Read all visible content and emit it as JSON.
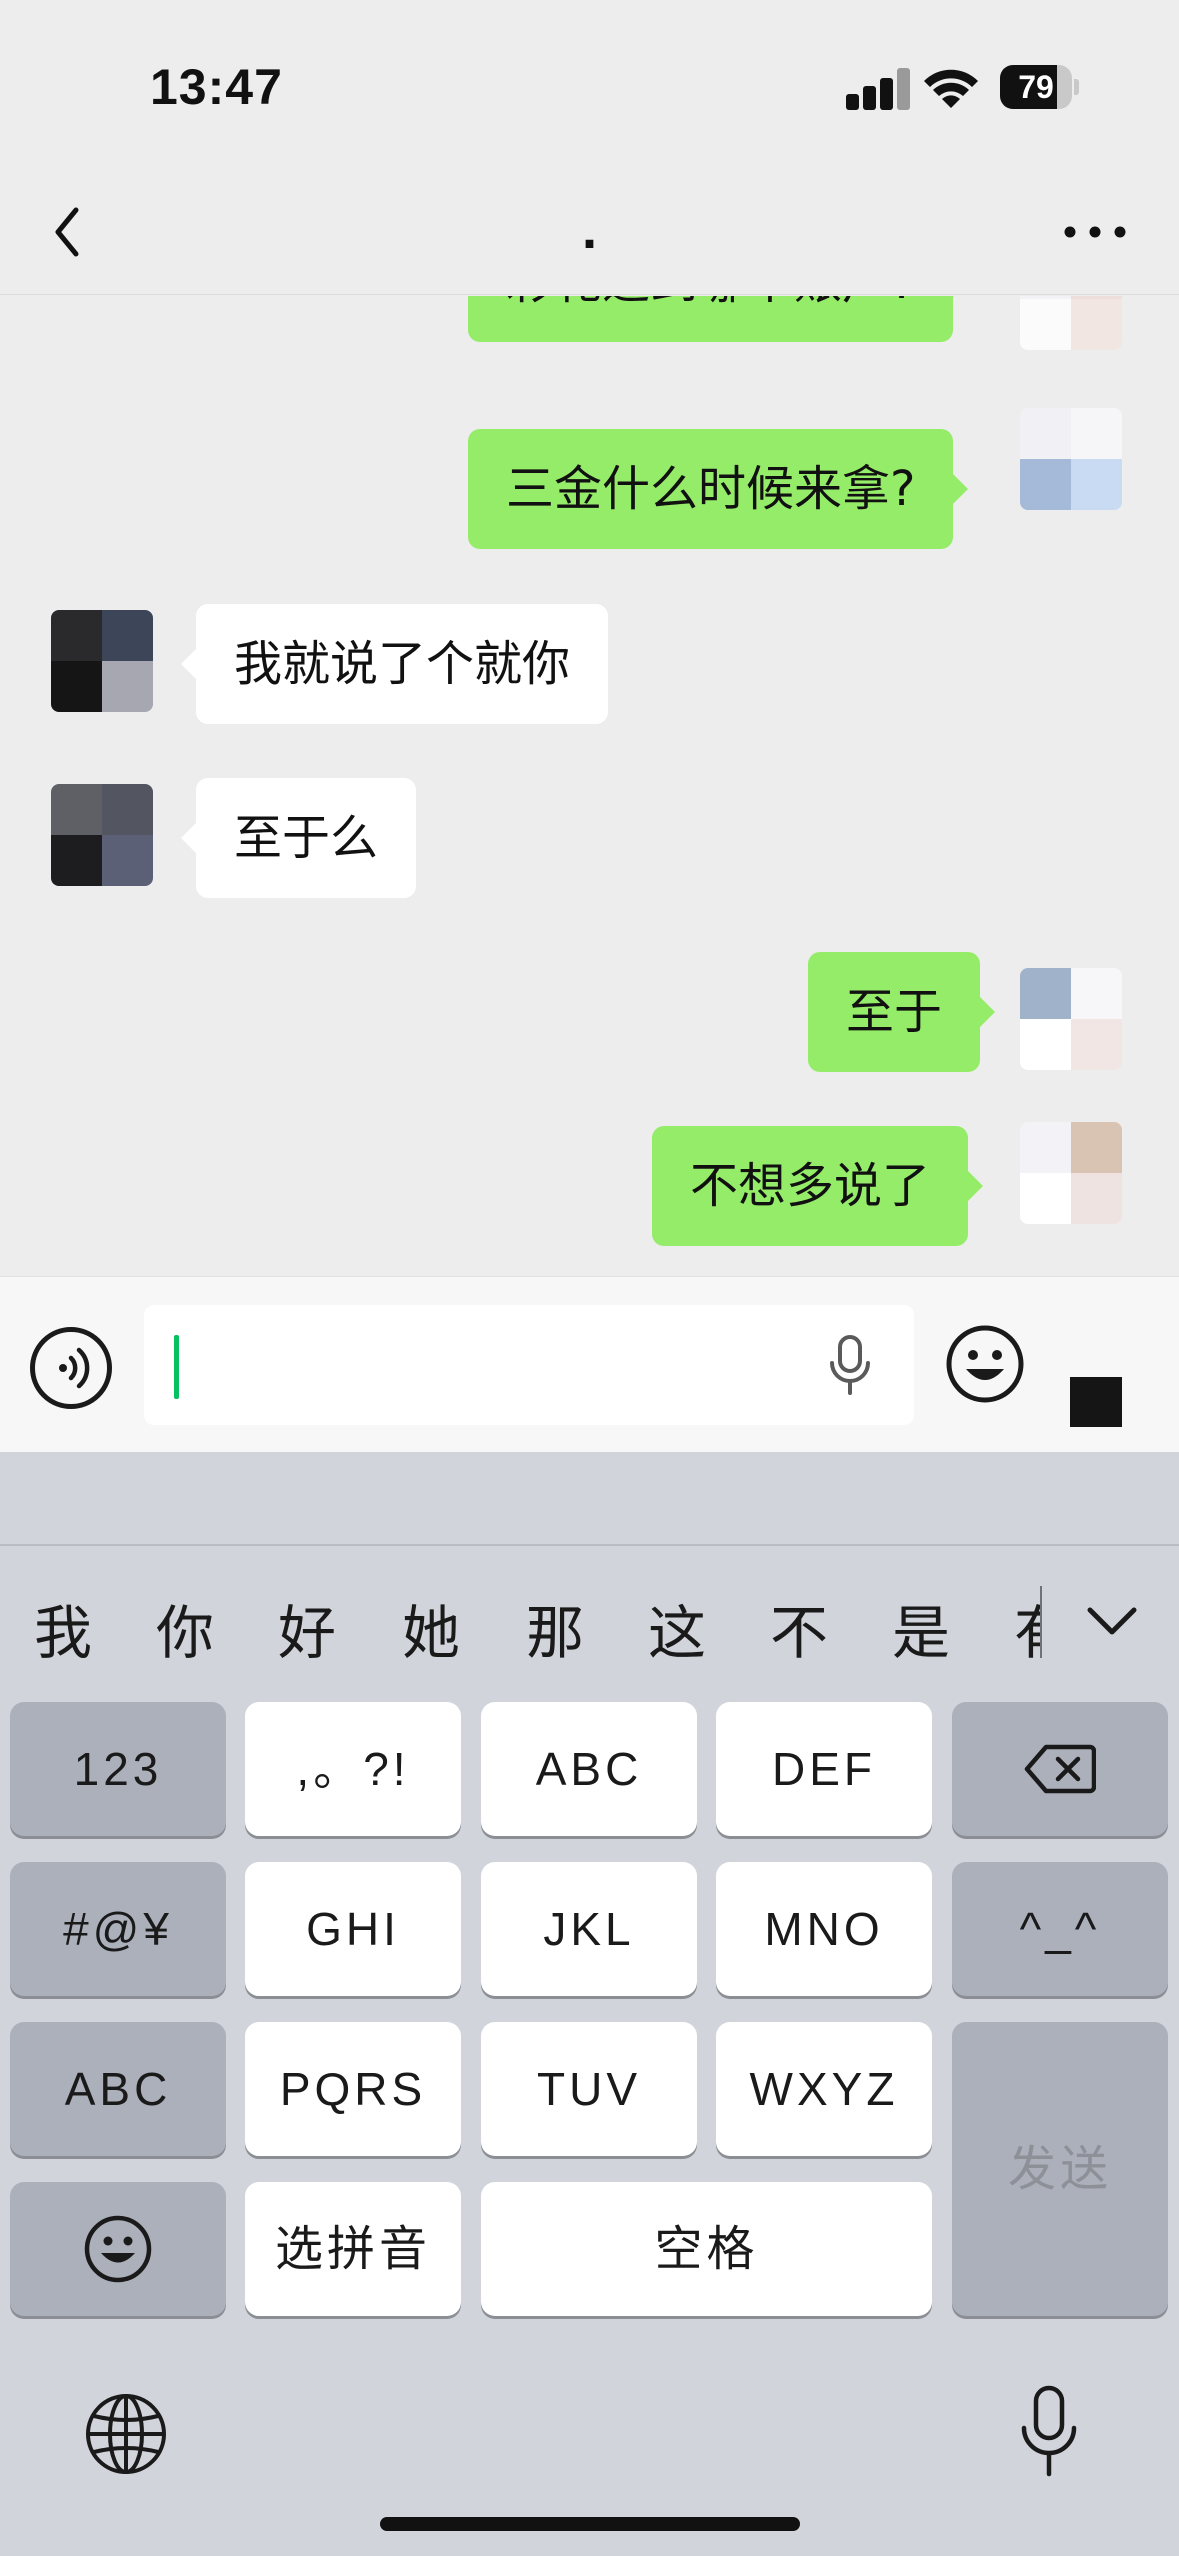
{
  "status_bar": {
    "time": "13:47",
    "battery_level": "79",
    "battery_fraction": 0.79
  },
  "nav": {
    "title": ".",
    "back_icon": "chevron-left-icon",
    "more_icon": "ellipsis-icon"
  },
  "messages": [
    {
      "side": "out",
      "text": "彩礼退到哪个账户?"
    },
    {
      "side": "out",
      "text": "三金什么时候来拿?"
    },
    {
      "side": "in",
      "text": "我就说了个就你"
    },
    {
      "side": "in",
      "text": "至于么"
    },
    {
      "side": "out",
      "text": "至于"
    },
    {
      "side": "out",
      "text": "不想多说了"
    }
  ],
  "input_bar": {
    "voice_icon": "voice-wave-icon",
    "mic_icon": "microphone-icon",
    "emoji_icon": "smiley-icon",
    "text": ""
  },
  "keyboard": {
    "candidates": [
      "我",
      "你",
      "好",
      "她",
      "那",
      "这",
      "不",
      "是",
      "有"
    ],
    "collapse_icon": "chevron-down-icon",
    "keys": {
      "numbers": "123",
      "punct": ",。?!",
      "abc": "ABC",
      "def": "DEF",
      "delete_icon": "backspace-icon",
      "symbols": "#@¥",
      "ghi": "GHI",
      "jkl": "JKL",
      "mno": "MNO",
      "kaomoji": "^_^",
      "abc_switch": "ABC",
      "pqrs": "PQRS",
      "tuv": "TUV",
      "wxyz": "WXYZ",
      "send": "发送",
      "emoji_icon": "smiley-icon",
      "pinyin": "选拼音",
      "space": "空格"
    },
    "globe_icon": "globe-icon",
    "dictation_icon": "microphone-icon"
  },
  "colors": {
    "outgoing_bubble": "#95ec69",
    "incoming_bubble": "#ffffff",
    "chat_bg": "#ededed",
    "caret": "#07c160",
    "keyboard_bg": "#d1d4db"
  }
}
